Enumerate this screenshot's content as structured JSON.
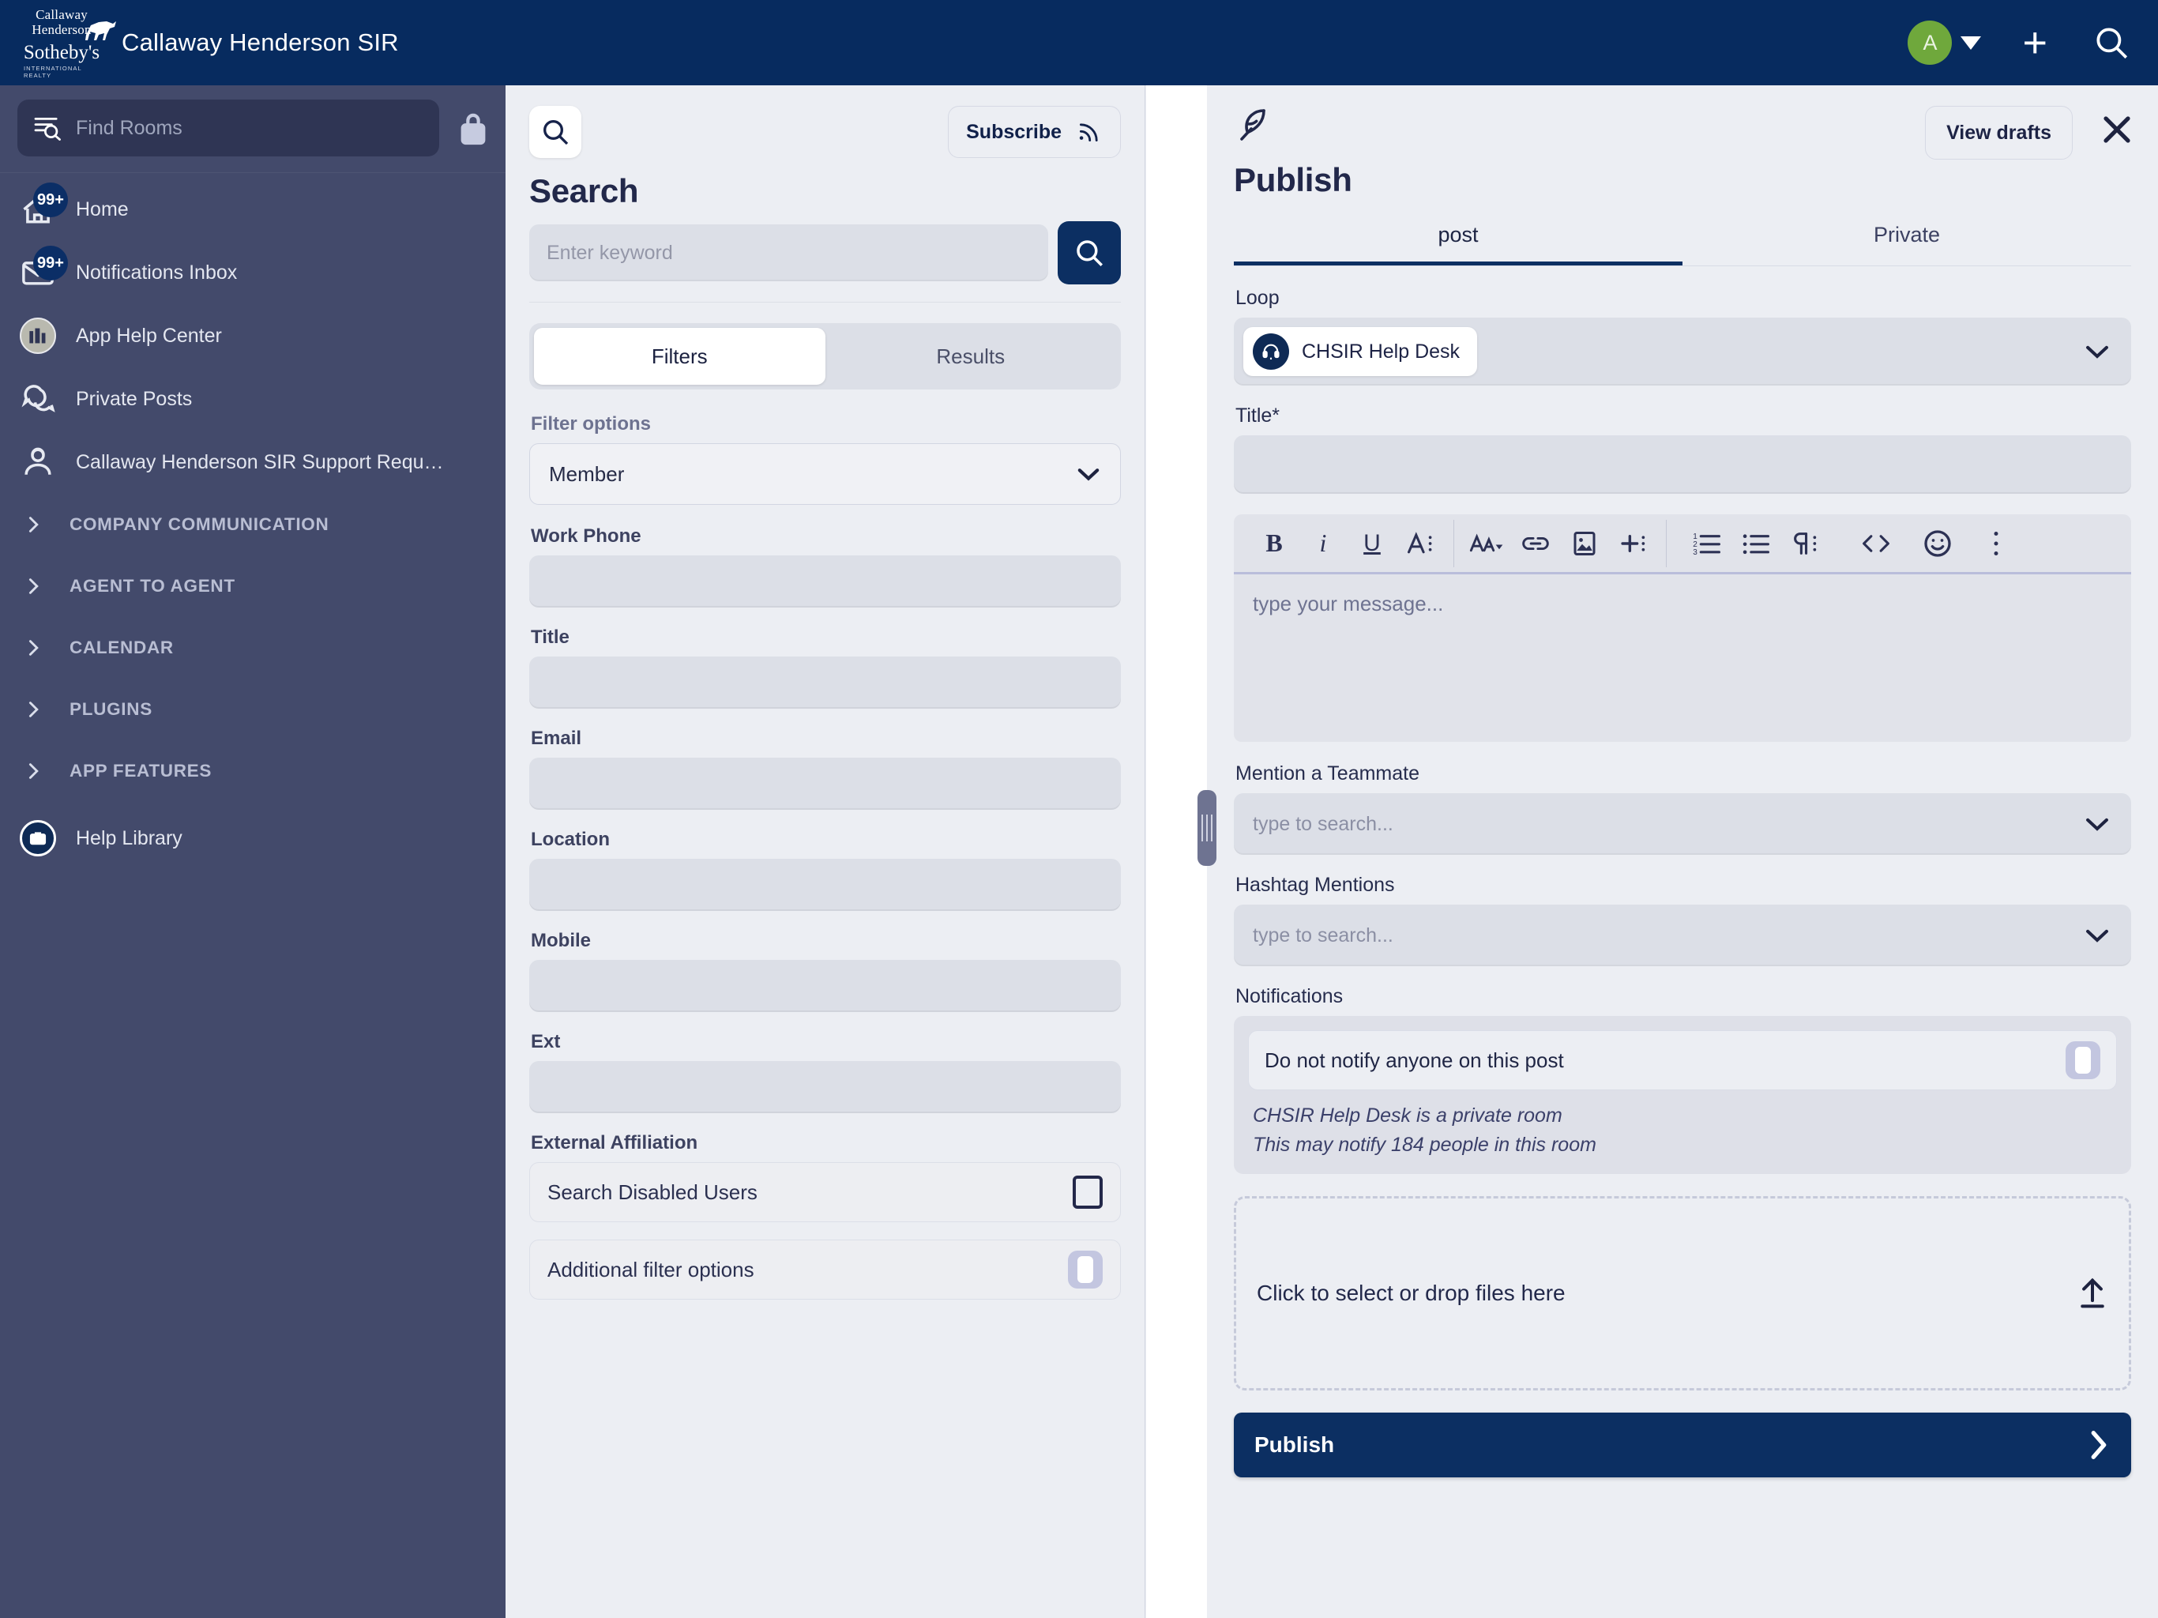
{
  "topbar": {
    "brand_line1": "Callaway",
    "brand_line2": "Henderson",
    "brand_line3": "Sotheby's",
    "brand_line4": "INTERNATIONAL REALTY",
    "title": "Callaway Henderson SIR",
    "avatar_initial": "A",
    "icons": [
      "avatar-caret-icon",
      "plus-icon",
      "search-icon"
    ]
  },
  "sidebar": {
    "search_placeholder": "Find Rooms",
    "lock_icon": "lock-icon",
    "items": [
      {
        "label": "Home",
        "icon": "home-icon",
        "badge": "99+"
      },
      {
        "label": "Notifications Inbox",
        "icon": "envelope-icon",
        "badge": "99+"
      },
      {
        "label": "App Help Center",
        "icon": "books-icon",
        "badge": ""
      },
      {
        "label": "Private Posts",
        "icon": "chat-bubbles-icon",
        "badge": ""
      },
      {
        "label": "Callaway Henderson SIR Support Requ…",
        "icon": "support-agent-icon",
        "badge": ""
      }
    ],
    "sections": [
      {
        "label": "COMPANY COMMUNICATION"
      },
      {
        "label": "AGENT TO AGENT"
      },
      {
        "label": "CALENDAR"
      },
      {
        "label": "PLUGINS"
      },
      {
        "label": "APP FEATURES"
      }
    ],
    "footer_item": {
      "label": "Help Library",
      "icon": "briefcase-icon"
    }
  },
  "search_panel": {
    "magnify_icon": "search-icon",
    "subscribe_label": "Subscribe",
    "subscribe_icon": "rss-icon",
    "heading": "Search",
    "keyword_placeholder": "Enter keyword",
    "keyword_value": "",
    "go_icon": "search-icon",
    "tabs": [
      {
        "label": "Filters",
        "active": true
      },
      {
        "label": "Results",
        "active": false
      }
    ],
    "filter_options_label": "Filter options",
    "filter_options_value": "Member",
    "fields": [
      {
        "label": "Work Phone",
        "value": ""
      },
      {
        "label": "Title",
        "value": ""
      },
      {
        "label": "Email",
        "value": ""
      },
      {
        "label": "Location",
        "value": ""
      },
      {
        "label": "Mobile",
        "value": ""
      },
      {
        "label": "Ext",
        "value": ""
      }
    ],
    "external_affiliation_label": "External Affiliation",
    "search_disabled_users_label": "Search Disabled Users",
    "search_disabled_users_checked": false,
    "additional_filter_options_label": "Additional filter options",
    "additional_filter_options_on": false
  },
  "publish_panel": {
    "feather_icon": "feather-pen-icon",
    "view_drafts_label": "View drafts",
    "close_icon": "close-icon",
    "heading": "Publish",
    "tabs": [
      {
        "label": "post",
        "active": true
      },
      {
        "label": "Private",
        "active": false
      }
    ],
    "loop_label": "Loop",
    "loop_value": "CHSIR Help Desk",
    "loop_avatar_icon": "headset-avatar-icon",
    "title_label": "Title*",
    "title_value": "",
    "title_placeholder": "",
    "toolbar": [
      {
        "name": "bold-icon",
        "glyph": "B"
      },
      {
        "name": "italic-icon",
        "glyph": "i"
      },
      {
        "name": "underline-icon",
        "glyph": "U"
      },
      {
        "name": "text-style-icon",
        "glyph": "A"
      },
      {
        "name": "font-size-icon",
        "glyph": "AA"
      },
      {
        "name": "link-icon",
        "glyph": "link"
      },
      {
        "name": "image-icon",
        "glyph": "image"
      },
      {
        "name": "insert-icon",
        "glyph": "plus"
      },
      {
        "name": "ordered-list-icon",
        "glyph": "ol"
      },
      {
        "name": "bullet-list-icon",
        "glyph": "ul"
      },
      {
        "name": "paragraph-icon",
        "glyph": "pilcrow"
      },
      {
        "name": "code-icon",
        "glyph": "<>"
      },
      {
        "name": "emoji-icon",
        "glyph": "smiley"
      },
      {
        "name": "more-options-icon",
        "glyph": "kebab"
      }
    ],
    "message_placeholder": "type your message...",
    "message_value": "",
    "mention_label": "Mention a Teammate",
    "mention_placeholder": "type to search...",
    "hashtag_label": "Hashtag Mentions",
    "hashtag_placeholder": "type to search...",
    "notifications_label": "Notifications",
    "do_not_notify_label": "Do not notify anyone on this post",
    "do_not_notify_on": false,
    "private_room_note": "CHSIR Help Desk is a private room",
    "people_note": "This may notify 184 people in this room",
    "dropzone_label": "Click to select or drop files here",
    "dropzone_icon": "upload-icon",
    "publish_label": "Publish",
    "publish_chevron_icon": "chevron-right-icon"
  },
  "colors": {
    "navy": "#072b5f",
    "sidebar": "#434a6b",
    "panel_bg": "#eceef3",
    "field_bg": "#dcdfe7",
    "accent": "#0c2f62",
    "avatar_green": "#6fa83c"
  }
}
